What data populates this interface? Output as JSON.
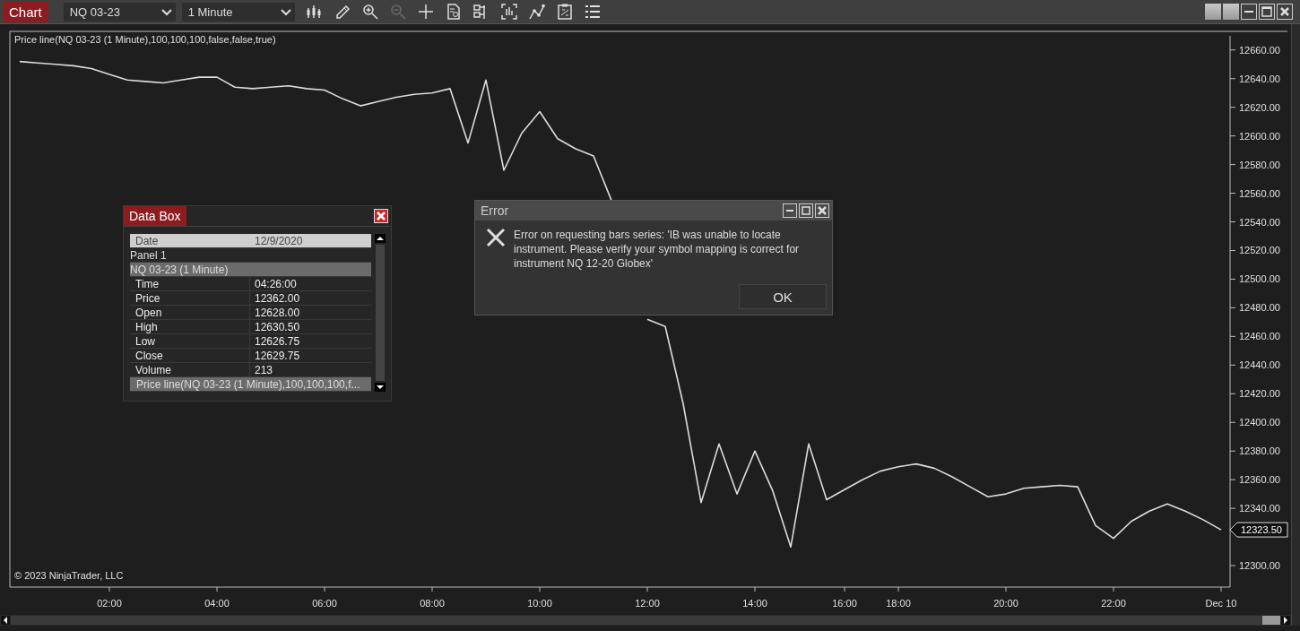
{
  "toolbar": {
    "title": "Chart",
    "instrument": "NQ 03-23",
    "interval": "1 Minute",
    "tools": [
      {
        "kind": "bars",
        "disabled": false
      },
      {
        "kind": "pencil",
        "disabled": false
      },
      {
        "kind": "zoom-in",
        "disabled": false
      },
      {
        "kind": "zoom-out",
        "disabled": true
      },
      {
        "kind": "crosshair",
        "disabled": false
      },
      {
        "kind": "document",
        "disabled": false
      },
      {
        "kind": "properties",
        "disabled": false
      },
      {
        "kind": "bar-chart",
        "disabled": false
      },
      {
        "kind": "line-chart",
        "disabled": false
      },
      {
        "kind": "template",
        "disabled": false
      },
      {
        "kind": "list",
        "disabled": false
      }
    ]
  },
  "chart": {
    "legend": "Price line(NQ 03-23 (1 Minute),100,100,100,false,false,true)",
    "copyright": "© 2023 NinjaTrader, LLC",
    "current_price": "12323.50",
    "chart_data": {
      "type": "line",
      "ylim": [
        12285,
        12673
      ],
      "categories": [
        null,
        null,
        null,
        null,
        null,
        "02:00",
        null,
        null,
        null,
        null,
        null,
        "04:00",
        null,
        null,
        null,
        null,
        null,
        "06:00",
        null,
        null,
        null,
        null,
        null,
        "08:00",
        null,
        null,
        null,
        null,
        null,
        "10:00",
        null,
        null,
        null,
        null,
        null,
        "12:00",
        null,
        null,
        null,
        null,
        null,
        "14:00",
        null,
        null,
        null,
        null,
        "16:00",
        null,
        null,
        "18:00",
        null,
        null,
        null,
        null,
        null,
        "20:00",
        null,
        null,
        null,
        null,
        null,
        "22:00",
        null,
        null,
        null,
        null,
        null,
        "Dec 10"
      ],
      "series": [
        {
          "color": "#dcdcdc",
          "values": [
            12652,
            12651,
            12650,
            12649,
            12647,
            12643,
            12639,
            12638,
            12637,
            12639,
            12641,
            12641,
            12634,
            12633,
            12634,
            12635,
            12633,
            12632,
            12626,
            12621,
            12624,
            12627,
            12629,
            12630,
            12633,
            12595,
            12639,
            12576,
            12602,
            12617,
            12598,
            12591,
            12586,
            12555,
            null,
            12472,
            12467,
            12413,
            12344,
            12385,
            12350,
            12380,
            12352,
            12313,
            12385,
            12346,
            12353,
            12360,
            12366,
            12369,
            12371,
            12368,
            12362,
            12355,
            12348,
            12350,
            12354,
            12355,
            12356,
            12355,
            12328,
            12319,
            12331,
            12338,
            12343,
            12338,
            12332,
            12325
          ]
        }
      ],
      "yticks": [
        {
          "value": 12300,
          "label": "12300.00"
        },
        {
          "value": 12340,
          "label": "12340.00"
        },
        {
          "value": 12360,
          "label": "12360.00"
        },
        {
          "value": 12380,
          "label": "12380.00"
        },
        {
          "value": 12400,
          "label": "12400.00"
        },
        {
          "value": 12420,
          "label": "12420.00"
        },
        {
          "value": 12440,
          "label": "12440.00"
        },
        {
          "value": 12460,
          "label": "12460.00"
        },
        {
          "value": 12480,
          "label": "12480.00"
        },
        {
          "value": 12500,
          "label": "12500.00"
        },
        {
          "value": 12520,
          "label": "12520.00"
        },
        {
          "value": 12540,
          "label": "12540.00"
        },
        {
          "value": 12560,
          "label": "12560.00"
        },
        {
          "value": 12580,
          "label": "12580.00"
        },
        {
          "value": 12600,
          "label": "12600.00"
        },
        {
          "value": 12620,
          "label": "12620.00"
        },
        {
          "value": 12640,
          "label": "12640.00"
        },
        {
          "value": 12660,
          "label": "12660.00"
        }
      ]
    }
  },
  "data_box": {
    "title": "Data Box",
    "date_label": "Date",
    "date": "12/9/2020",
    "panel": "Panel 1",
    "series_header": "NQ 03-23 (1 Minute)",
    "rows": [
      {
        "label": "Time",
        "value": "04:26:00"
      },
      {
        "label": "Price",
        "value": "12362.00"
      },
      {
        "label": "Open",
        "value": "12628.00"
      },
      {
        "label": "High",
        "value": "12630.50"
      },
      {
        "label": "Low",
        "value": "12626.75"
      },
      {
        "label": "Close",
        "value": "12629.75"
      },
      {
        "label": "Volume",
        "value": "213"
      }
    ],
    "indicator_header": "Price line(NQ 03-23 (1 Minute),100,100,100,f..."
  },
  "dialog": {
    "title": "Error",
    "message": "Error on requesting bars series: 'IB was unable to locate instrument. Please verify your symbol mapping is correct for instrument NQ 12-20 Globex'",
    "button": "OK"
  }
}
